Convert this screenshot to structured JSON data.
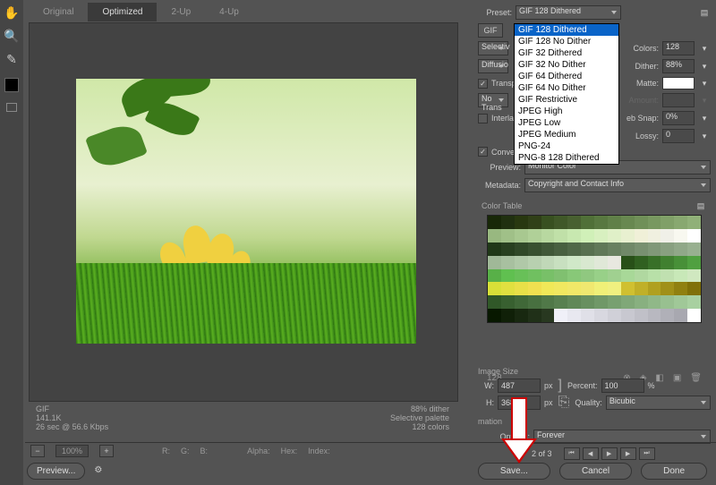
{
  "tabs": [
    "Original",
    "Optimized",
    "2-Up",
    "4-Up"
  ],
  "active_tab": "Optimized",
  "preset": {
    "label": "Preset:",
    "value": "GIF 128 Dithered",
    "options": [
      "GIF 128 Dithered",
      "GIF 128 No Dither",
      "GIF 32 Dithered",
      "GIF 32 No Dither",
      "GIF 64 Dithered",
      "GIF 64 No Dither",
      "GIF Restrictive",
      "JPEG High",
      "JPEG Low",
      "JPEG Medium",
      "PNG-24",
      "PNG-8 128 Dithered"
    ]
  },
  "format_badge": "GIF",
  "left_settings": {
    "selective_label": "Selectiv",
    "diffusion_label": "Diffusio",
    "transparency": "Transp",
    "no_trans": "No Trans",
    "interlaced": "Interla",
    "convert_srgb": "Convert to sRGB"
  },
  "right_settings": {
    "colors": {
      "label": "Colors:",
      "value": "128"
    },
    "dither": {
      "label": "Dither:",
      "value": "88%"
    },
    "matte": {
      "label": "Matte:"
    },
    "amount": {
      "label": "Amount:"
    },
    "web_snap": {
      "label": "eb Snap:",
      "value": "0%"
    },
    "lossy": {
      "label": "Lossy:",
      "value": "0"
    }
  },
  "preview": {
    "label": "Preview:",
    "value": "Monitor Color"
  },
  "metadata": {
    "label": "Metadata:",
    "value": "Copyright and Contact Info"
  },
  "color_table": {
    "label": "Color Table",
    "count": "128"
  },
  "image_size": {
    "label": "Image Size",
    "w": {
      "label": "W:",
      "value": "487",
      "unit": "px"
    },
    "h": {
      "label": "H:",
      "value": "368",
      "unit": "px"
    },
    "percent": {
      "label": "Percent:",
      "value": "100",
      "unit": "%"
    },
    "quality": {
      "label": "Quality:",
      "value": "Bicubic"
    }
  },
  "animation": {
    "label": "mation",
    "options_label": "Options:",
    "options_value": "Forever",
    "frame_text": "2 of 3"
  },
  "info": {
    "format": "GIF",
    "size": "141.1K",
    "time": "26 sec @ 56.6 Kbps",
    "dither": "88% dither",
    "palette": "Selective palette",
    "colors": "128 colors"
  },
  "bottom": {
    "zoom": "100%",
    "r": "R:",
    "g": "G:",
    "b": "B:",
    "alpha": "Alpha:",
    "hex": "Hex:",
    "index": "Index:"
  },
  "buttons": {
    "preview": "Preview...",
    "save": "Save...",
    "cancel": "Cancel",
    "done": "Done"
  },
  "palette_colors": [
    "#182808",
    "#203010",
    "#283810",
    "#304018",
    "#385020",
    "#405828",
    "#486030",
    "#507038",
    "#587840",
    "#608048",
    "#688850",
    "#709058",
    "#789860",
    "#80a068",
    "#88a870",
    "#90b078",
    "#98b880",
    "#a0c088",
    "#a8c890",
    "#b0d098",
    "#b8d8a0",
    "#c0e0a8",
    "#c8e8b0",
    "#d0f0b8",
    "#d8f0c0",
    "#e0f0c8",
    "#e8f0d0",
    "#f0f0d8",
    "#f0f0e0",
    "#f0f0e8",
    "#f8f8f0",
    "#ffffff",
    "#203818",
    "#284020",
    "#304828",
    "#385030",
    "#405838",
    "#486040",
    "#506848",
    "#587050",
    "#607858",
    "#688060",
    "#708868",
    "#789070",
    "#809878",
    "#88a080",
    "#90a888",
    "#98b090",
    "#a0b898",
    "#a8c0a0",
    "#b0c8a8",
    "#b8d0b0",
    "#c0d8b8",
    "#c8e0c0",
    "#d0e8c8",
    "#d8e8d0",
    "#e0e8d8",
    "#e8e8e0",
    "#285018",
    "#306020",
    "#387028",
    "#408030",
    "#489038",
    "#50a040",
    "#58b048",
    "#60c050",
    "#68c058",
    "#70c060",
    "#78c068",
    "#80c070",
    "#88c878",
    "#90c880",
    "#98d088",
    "#a0d090",
    "#a8d898",
    "#b0d8a0",
    "#b8e0a8",
    "#c0e0b0",
    "#c8e8b8",
    "#d0e8c0",
    "#d8e038",
    "#e0e040",
    "#e8e048",
    "#f0e050",
    "#f0e858",
    "#f0e860",
    "#f0e868",
    "#f0e870",
    "#f0f078",
    "#f0f080",
    "#d0c030",
    "#c0b028",
    "#b0a020",
    "#a09018",
    "#908010",
    "#807008",
    "#305828",
    "#386030",
    "#406838",
    "#487040",
    "#507848",
    "#588050",
    "#608858",
    "#689060",
    "#709868",
    "#78a070",
    "#80a878",
    "#88b080",
    "#90b888",
    "#98c090",
    "#a0c898",
    "#a8d0a0",
    "#081800",
    "#102008",
    "#182810",
    "#203018",
    "#283820",
    "#f0f0f8",
    "#e8e8f0",
    "#e0e0e8",
    "#d8d8e0",
    "#d0d0d8",
    "#c8c8d0",
    "#c0c0c8",
    "#b8b8c0",
    "#b0b0b8",
    "#a8a8b0",
    "#ffffff"
  ]
}
